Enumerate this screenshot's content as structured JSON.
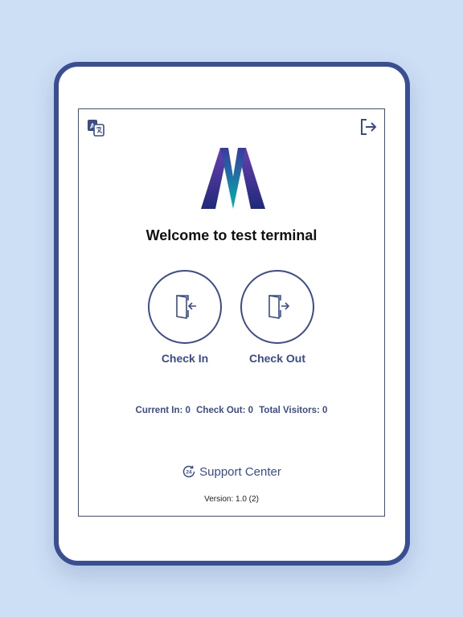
{
  "welcome_text": "Welcome to test terminal",
  "actions": {
    "check_in_label": "Check In",
    "check_out_label": "Check Out"
  },
  "stats": {
    "current_in": "Current In: 0",
    "check_out": "Check Out: 0",
    "total_visitors": "Total Visitors: 0"
  },
  "support": {
    "label": "Support Center",
    "badge": "24"
  },
  "version": "Version: 1.0 (2)",
  "icons": {
    "language": "translate-icon",
    "logout": "logout-icon",
    "check_in": "door-enter-icon",
    "check_out": "door-exit-icon",
    "support": "24-hour-support-icon"
  },
  "colors": {
    "accent": "#3a4c8c",
    "background": "#cddff5",
    "device_frame": "#394f93"
  }
}
